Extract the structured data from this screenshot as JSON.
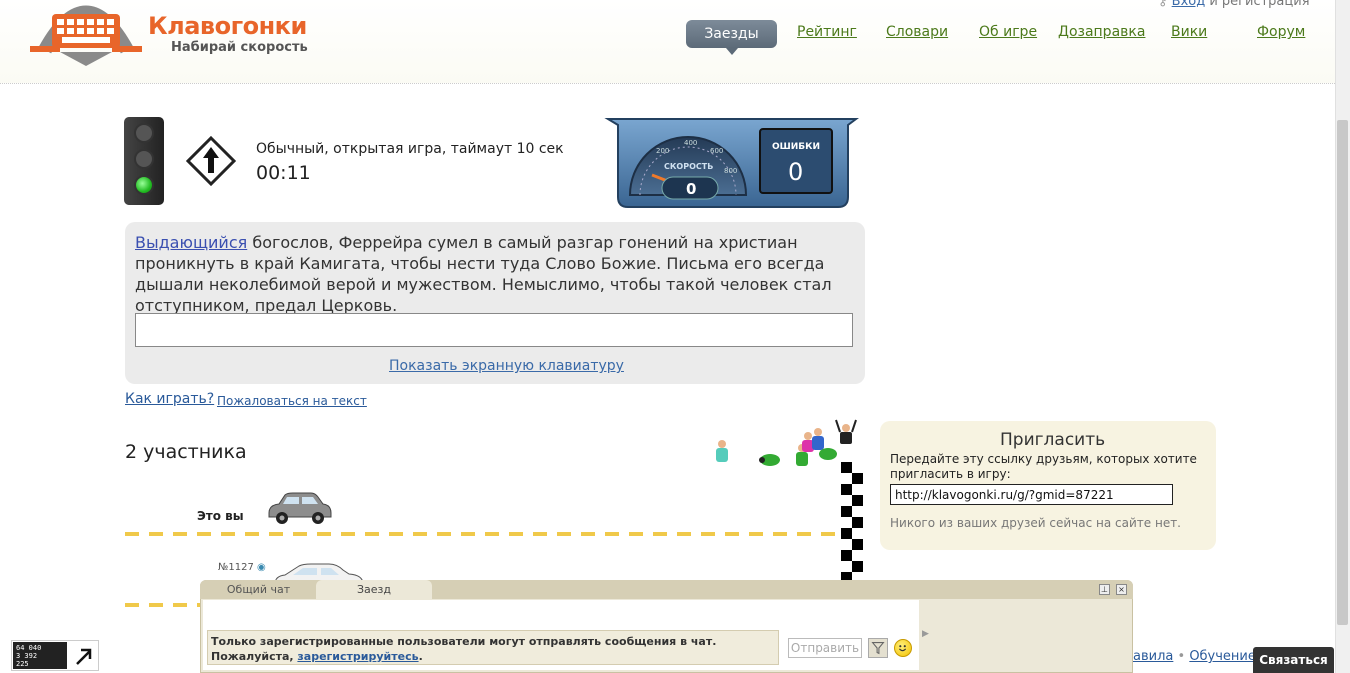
{
  "header": {
    "logo_title": "Клавогонки",
    "logo_subtitle": "Набирай скорость",
    "login_link": "Вход",
    "login_suffix": " и регистрация",
    "nav": [
      {
        "label": "Заезды",
        "active": true
      },
      {
        "label": "Рейтинг"
      },
      {
        "label": "Словари"
      },
      {
        "label": "Об игре"
      },
      {
        "label": "Дозаправка"
      },
      {
        "label": "Вики"
      },
      {
        "label": "Форум"
      }
    ]
  },
  "game": {
    "description": "Обычный, открытая игра, таймаут 10 сек",
    "timer": "00:11",
    "speed_label": "СКОРОСТЬ",
    "speed_value": "0",
    "speed_ticks": [
      "200",
      "400",
      "600",
      "800"
    ],
    "errors_label": "ОШИБКИ",
    "errors_value": "0"
  },
  "text": {
    "typed_word": "Выдающийся",
    "rest": " богослов, Феррейра сумел в самый разгар гонений на христиан проникнуть в край Камигата, чтобы нести туда Слово Божие. Письма его всегда дышали неколебимой верой и мужеством. Немыслимо, чтобы такой человек стал отступником, предал Церковь.",
    "input_value": "",
    "keyboard_link": "Показать экранную клавиатуру"
  },
  "links": {
    "how_to_play": "Как играть?",
    "complain": "Пожаловаться на текст"
  },
  "race": {
    "participants": "2 участника",
    "you_label": "Это вы",
    "rival_label": "№1127"
  },
  "invite": {
    "title": "Пригласить",
    "text": "Передайте эту ссылку друзьям, которых хотите пригласить в игру:",
    "url": "http://klavogonki.ru/g/?gmid=87221",
    "note": "Никого из ваших друзей сейчас на сайте нет."
  },
  "chat": {
    "tabs": [
      "Общий чат",
      "Заезд"
    ],
    "active_tab": "Заезд",
    "warning_text": "Только зарегистрированные пользователи могут отправлять сообщения в чат. Пожалуйста, ",
    "warning_link": "зарегистрируйтесь",
    "warning_end": ".",
    "send_label": "Отправить"
  },
  "footer": {
    "rules_link": "авила",
    "separator": "•",
    "learning_link": "Обучение",
    "contact_button": "Связаться"
  },
  "counter": {
    "line1": "64 040",
    "line2": "3 392",
    "line3": "225"
  },
  "colors": {
    "accent_orange": "#e8652a",
    "nav_green": "#4c7a1b",
    "link_blue": "#2a5a9a",
    "lane_yellow": "#f0c94a"
  }
}
